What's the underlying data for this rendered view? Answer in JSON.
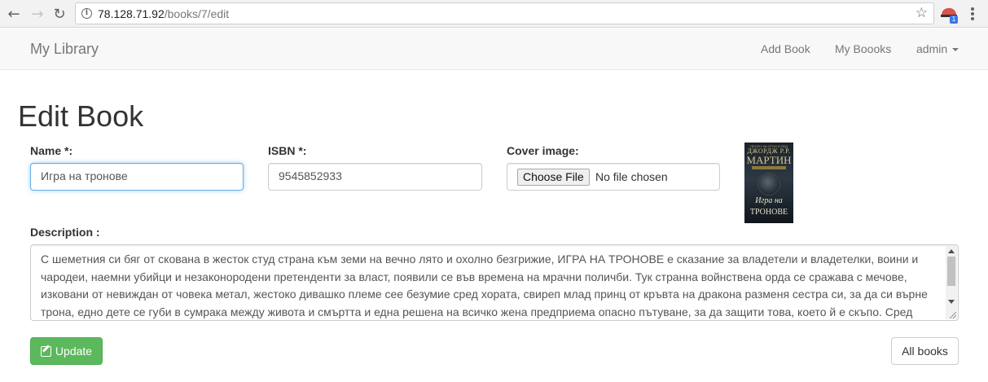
{
  "browser": {
    "url_host": "78.128.71.92",
    "url_path": "/books/7/edit",
    "extension_badge": "1"
  },
  "navbar": {
    "brand": "My Library",
    "links": [
      "Add Book",
      "My Boooks"
    ],
    "user_menu": "admin"
  },
  "page": {
    "title": "Edit Book"
  },
  "form": {
    "name_label": "Name *:",
    "name_value": "Игра на тронове",
    "isbn_label": "ISBN *:",
    "isbn_value": "9545852933",
    "cover_label": "Cover image:",
    "choose_file": "Choose File",
    "file_status": "No file chosen",
    "description_label": "Description :",
    "description_value": "С шеметния си бяг от скована в жесток студ страна към земи на вечно лято и охолно безгрижие, ИГРА НА ТРОНОВЕ е сказание за владетели и владетелки, воини и чародеи, наемни убийци и незаконородени претенденти за власт, появили се във времена на мрачни поличби. Тук странна войнствена орда се сражава с мечове, изковани от невиждан от човека метал, жестоко дивашко племе сее безумие сред хората, свиреп млад принц от кръвта на дракона разменя сестра си, за да си върне трона, едно дете се губи в сумрака между живота и смъртта и една решена на всичко жена предприема опасно пътуване, за да защити това, което й е скъпо. Сред"
  },
  "cover": {
    "top_text": "ПЕСЕН ЗА ОГЪН И ЛЕД",
    "author": "ДЖОРДЖ Р.Р.",
    "surname": "МАРТИН",
    "title_line1": "Игра на",
    "title_line2": "ТРОНОВЕ"
  },
  "actions": {
    "update": "Update",
    "all_books": "All books"
  },
  "colors": {
    "update_button": "#5cb85c",
    "focus_border": "#66afe9"
  }
}
